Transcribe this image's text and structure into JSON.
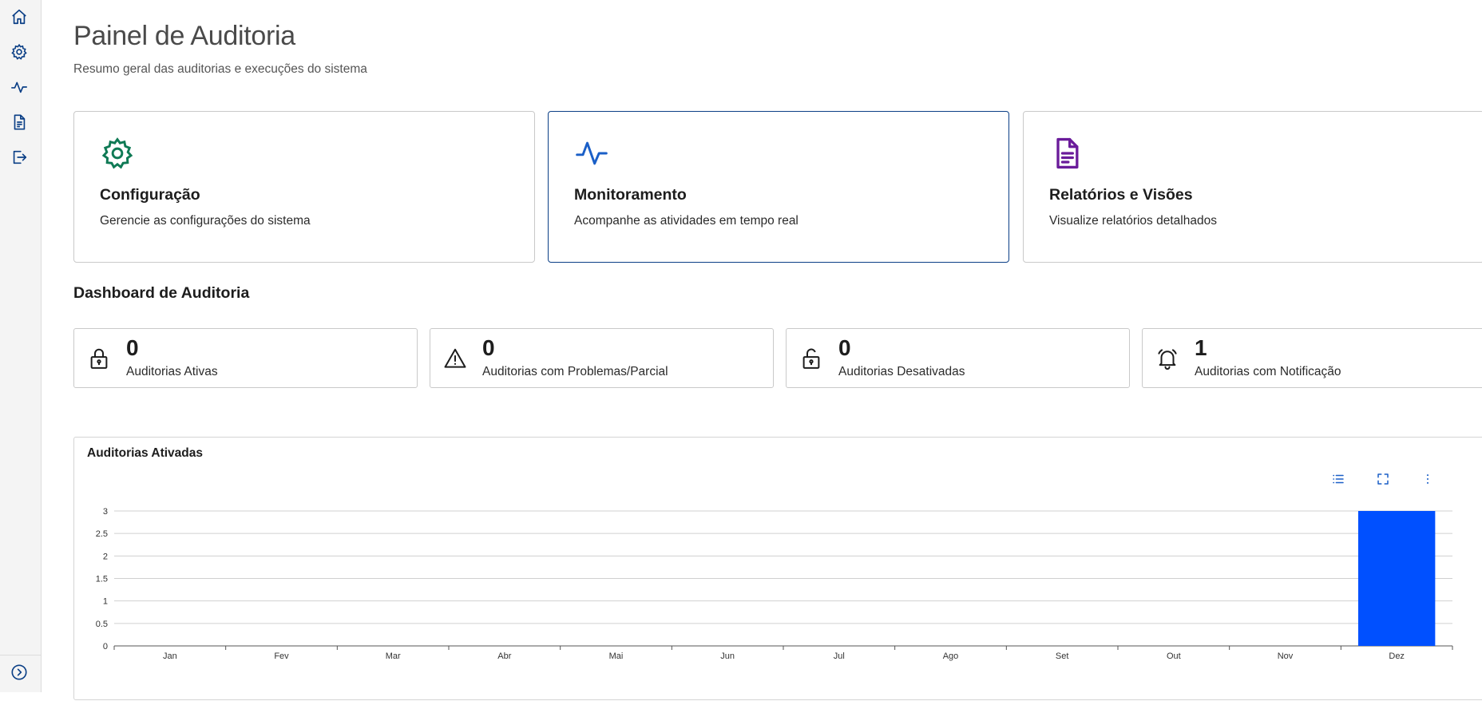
{
  "sidebar": {
    "items": [
      {
        "icon": "home-icon"
      },
      {
        "icon": "gear-icon"
      },
      {
        "icon": "activity-icon"
      },
      {
        "icon": "document-icon"
      },
      {
        "icon": "logout-icon"
      }
    ],
    "expand_icon": "expand-chevron-icon"
  },
  "header": {
    "title": "Painel de Auditoria",
    "subtitle": "Resumo geral das auditorias e execuções do sistema"
  },
  "cards": [
    {
      "title": "Configuração",
      "description": "Gerencie as configurações do sistema",
      "icon": "gear-icon",
      "color": "#0f7a55"
    },
    {
      "title": "Monitoramento",
      "description": "Acompanhe as atividades em tempo real",
      "icon": "activity-icon",
      "color": "#1a5fc7"
    },
    {
      "title": "Relatórios e Visões",
      "description": "Visualize relatórios detalhados",
      "icon": "document-icon",
      "color": "#6a1b9a"
    }
  ],
  "dashboard": {
    "title": "Dashboard de Auditoria",
    "stats": [
      {
        "value": "0",
        "label": "Auditorias Ativas",
        "icon": "lock-icon"
      },
      {
        "value": "0",
        "label": "Auditorias com Problemas/Parcial",
        "icon": "warning-icon"
      },
      {
        "value": "0",
        "label": "Auditorias Desativadas",
        "icon": "unlock-icon"
      },
      {
        "value": "1",
        "label": "Auditorias com Notificação",
        "icon": "bell-icon"
      }
    ]
  },
  "chart_panel": {
    "title": "Auditorias Ativadas",
    "tools": [
      "list-icon",
      "fullscreen-icon",
      "more-vertical-icon"
    ]
  },
  "chart_data": {
    "type": "bar",
    "title": "Auditorias Ativadas",
    "categories": [
      "Jan",
      "Fev",
      "Mar",
      "Abr",
      "Mai",
      "Jun",
      "Jul",
      "Ago",
      "Set",
      "Out",
      "Nov",
      "Dez"
    ],
    "values": [
      0,
      0,
      0,
      0,
      0,
      0,
      0,
      0,
      0,
      0,
      0,
      3
    ],
    "ylim": [
      0,
      3
    ],
    "yticks": [
      "0",
      "0.5",
      "1",
      "1.5",
      "2",
      "2.5",
      "3"
    ],
    "grid": true,
    "bar_color": "#0050ff",
    "xlabel": "",
    "ylabel": ""
  },
  "colors": {
    "accent": "#0b3f86",
    "sidebar_icon": "#0b3f86"
  }
}
